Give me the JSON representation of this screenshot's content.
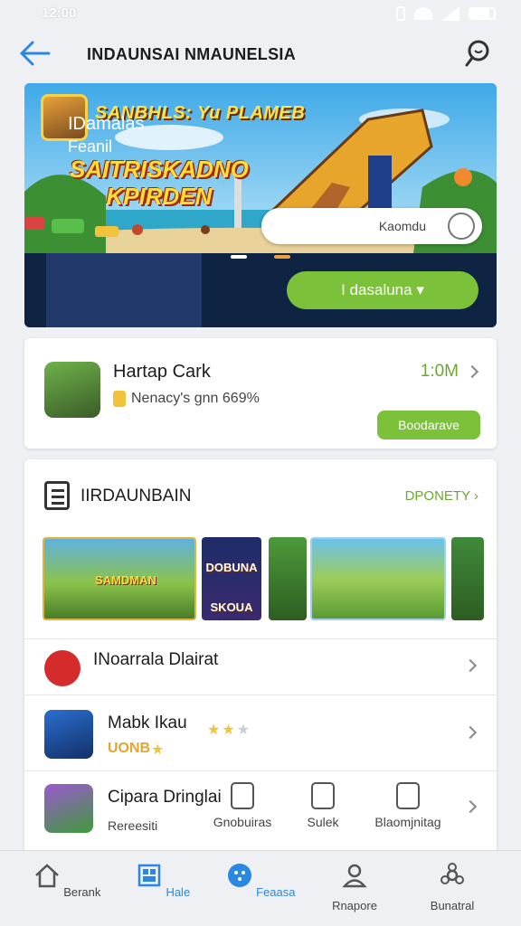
{
  "status_bar": {
    "time": "12:00"
  },
  "header": {
    "title": "INDAUNSAI NMAUNELSIA"
  },
  "banner": {
    "logo_text": "SANBHLS: Yu PLAMEB",
    "title_line1": "SAITRISKADNO",
    "title_line2": "KPIRDEN",
    "search_text": "Kaomdu",
    "promo_title": "IDamalas",
    "promo_sub": "Feanil",
    "pill_label": "I dasaluna ▾"
  },
  "featured_app": {
    "name": "Hartap Cark",
    "subtitle": "Nenacy's gnn 669%",
    "size": "1:0M",
    "button_label": "Boodarave"
  },
  "section": {
    "title": "IIRDAUNBAIN",
    "link_label": "DPONETY",
    "thumbnails": [
      {
        "text": "SAMDMAN"
      },
      {
        "text": "DOBUNA SKOUA"
      },
      {
        "text": ""
      },
      {
        "text": ""
      },
      {
        "text": ""
      }
    ],
    "rows": [
      {
        "name": "INoarrala Dlairat"
      },
      {
        "name": "Mabk Ikau",
        "sub": "UONB"
      },
      {
        "name": "Cipara Dringlai",
        "sub": "Rereesiti"
      }
    ],
    "quick_actions": [
      {
        "label": "Gnobuiras"
      },
      {
        "label": "Sulek"
      },
      {
        "label": "Blaomjnitag"
      }
    ]
  },
  "bottom_nav": [
    {
      "label": "Berank",
      "icon": "home-icon",
      "active": false
    },
    {
      "label": "Hale",
      "icon": "grid-icon",
      "active": true
    },
    {
      "label": "Feaasa",
      "icon": "globe-icon",
      "active": true
    },
    {
      "label": "Rnapore",
      "icon": "person-icon",
      "active": false
    },
    {
      "label": "Bunatral",
      "icon": "gear-icon",
      "active": false
    }
  ],
  "colors": {
    "accent_green": "#7cc13a",
    "accent_blue": "#2a88e0",
    "banner_navy": "#0f2343"
  }
}
